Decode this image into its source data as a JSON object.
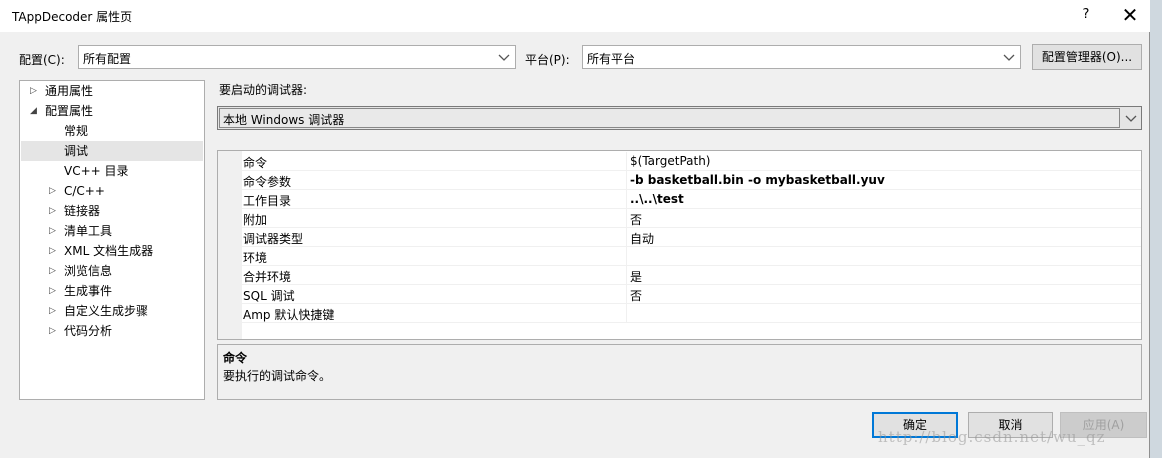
{
  "window": {
    "title": "TAppDecoder 属性页",
    "help_glyph": "?",
    "close_glyph": "✕"
  },
  "toolbar": {
    "config_label": "配置(C):",
    "config_value": "所有配置",
    "platform_label": "平台(P):",
    "platform_value": "所有平台",
    "config_manager_label": "配置管理器(O)..."
  },
  "tree": {
    "items": [
      {
        "label": "通用属性",
        "expander": "▷"
      },
      {
        "label": "配置属性",
        "expander": "◢"
      },
      {
        "label": "常规",
        "expander": ""
      },
      {
        "label": "调试",
        "expander": ""
      },
      {
        "label": "VC++ 目录",
        "expander": ""
      },
      {
        "label": "C/C++",
        "expander": "▷"
      },
      {
        "label": "链接器",
        "expander": "▷"
      },
      {
        "label": "清单工具",
        "expander": "▷"
      },
      {
        "label": "XML 文档生成器",
        "expander": "▷"
      },
      {
        "label": "浏览信息",
        "expander": "▷"
      },
      {
        "label": "生成事件",
        "expander": "▷"
      },
      {
        "label": "自定义生成步骤",
        "expander": "▷"
      },
      {
        "label": "代码分析",
        "expander": "▷"
      }
    ],
    "selected": "调试"
  },
  "debugger": {
    "label": "要启动的调试器:",
    "value": "本地 Windows 调试器"
  },
  "properties": {
    "rows": [
      {
        "key": "命令",
        "value": "$(TargetPath)",
        "bold": false
      },
      {
        "key": "命令参数",
        "value": "-b basketball.bin -o mybasketball.yuv",
        "bold": true
      },
      {
        "key": "工作目录",
        "value": "..\\..\\test",
        "bold": true
      },
      {
        "key": "附加",
        "value": "否",
        "bold": false
      },
      {
        "key": "调试器类型",
        "value": "自动",
        "bold": false
      },
      {
        "key": "环境",
        "value": "",
        "bold": false
      },
      {
        "key": "合并环境",
        "value": "是",
        "bold": false
      },
      {
        "key": "SQL 调试",
        "value": "否",
        "bold": false
      },
      {
        "key": "Amp 默认快捷键",
        "value": "",
        "bold": false
      }
    ]
  },
  "description": {
    "title": "命令",
    "text": "要执行的调试命令。"
  },
  "buttons": {
    "ok": "确定",
    "cancel": "取消",
    "apply": "应用(A)"
  },
  "watermark": "http://blog.csdn.net/wu_qz",
  "colors": {
    "dialog_bg": "#f0f0f0",
    "default_button_border": "#0078d7",
    "selection": "#e5e5e5"
  }
}
